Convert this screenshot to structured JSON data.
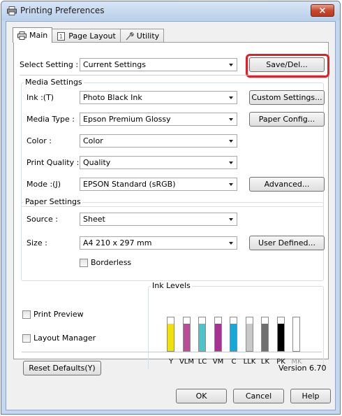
{
  "window": {
    "title": "Printing Preferences",
    "close_label": "×"
  },
  "tabs": [
    {
      "label": "Main"
    },
    {
      "label": "Page Layout"
    },
    {
      "label": "Utility"
    }
  ],
  "select_setting": {
    "label": "Select Setting :",
    "value": "Current Settings",
    "button": "Save/Del..."
  },
  "media_settings": {
    "title": "Media Settings",
    "ink": {
      "label": "Ink :(T)",
      "value": "Photo Black Ink",
      "button": "Custom Settings..."
    },
    "media_type": {
      "label": "Media Type :",
      "value": "Epson Premium Glossy",
      "button": "Paper Config..."
    },
    "color": {
      "label": "Color :",
      "value": "Color"
    },
    "print_quality": {
      "label": "Print Quality :",
      "value": "Quality"
    },
    "mode": {
      "label": "Mode :(J)",
      "value": "EPSON Standard (sRGB)",
      "button": "Advanced..."
    }
  },
  "paper_settings": {
    "title": "Paper Settings",
    "source": {
      "label": "Source :",
      "value": "Sheet"
    },
    "size": {
      "label": "Size :",
      "value": "A4 210 x 297 mm",
      "button": "User Defined..."
    },
    "borderless": "Borderless"
  },
  "options": {
    "print_preview": "Print Preview",
    "layout_manager": "Layout Manager"
  },
  "ink_levels": {
    "title": "Ink Levels",
    "inks": [
      {
        "name": "Y",
        "color": "#f0e010",
        "level": 0.82
      },
      {
        "name": "VLM",
        "color": "#c04a9a",
        "level": 0.82
      },
      {
        "name": "LC",
        "color": "#4cc4cc",
        "level": 0.82
      },
      {
        "name": "VM",
        "color": "#a83294",
        "level": 0.82
      },
      {
        "name": "C",
        "color": "#18a8d8",
        "level": 0.82
      },
      {
        "name": "LLK",
        "color": "#c8c8c8",
        "level": 0.82
      },
      {
        "name": "LK",
        "color": "#707070",
        "level": 0.82
      },
      {
        "name": "PK",
        "color": "#000000",
        "level": 0.82
      },
      {
        "name": "MK",
        "color": "#ffffff",
        "level": 0.0
      }
    ]
  },
  "footer": {
    "reset": "Reset Defaults(Y)",
    "version": "Version 6.70",
    "ok": "OK",
    "cancel": "Cancel",
    "help": "Help"
  }
}
